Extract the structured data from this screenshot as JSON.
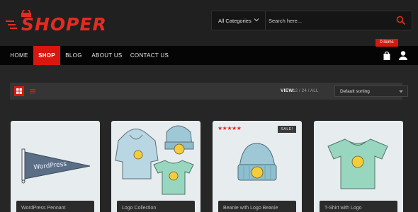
{
  "brand": {
    "name": "SHOPER"
  },
  "search": {
    "category": "All Categories",
    "placeholder": "Search here..."
  },
  "nav": {
    "items": [
      "HOME",
      "SHOP",
      "BLOG",
      "ABOUT US",
      "CONTACT US"
    ],
    "active": "SHOP"
  },
  "cart": {
    "badge": "0 items"
  },
  "toolbar": {
    "view_label": "VIEW:",
    "view_options": "12 / 24 / ALL",
    "sort_value": "Default sorting"
  },
  "products": [
    {
      "title": "WordPress Pennant",
      "pennant_text": "WordPress"
    },
    {
      "title": "Logo Collection"
    },
    {
      "title": "Beanie with Logo Beanie",
      "rating": 5,
      "badge": "SALE!"
    },
    {
      "title": "T-Shirt with Logo"
    }
  ],
  "colors": {
    "accent": "#d8180f",
    "header_bg": "#202020",
    "nav_bg": "#050505",
    "page_bg": "#262626",
    "card_bg": "#e7ecef"
  },
  "icons": [
    "search-icon",
    "chevron-down-icon",
    "cart-icon",
    "user-icon",
    "grid-view-icon",
    "list-view-icon",
    "star-icon"
  ]
}
